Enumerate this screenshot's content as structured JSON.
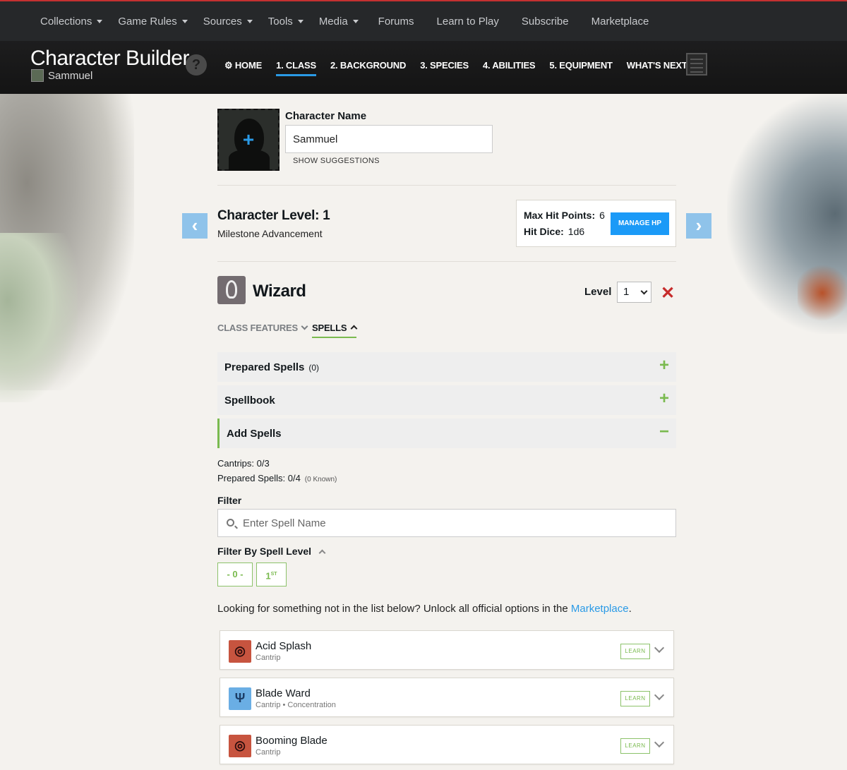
{
  "topnav": {
    "items": [
      {
        "label": "Collections",
        "dropdown": true
      },
      {
        "label": "Game Rules",
        "dropdown": true
      },
      {
        "label": "Sources",
        "dropdown": true
      },
      {
        "label": "Tools",
        "dropdown": true
      },
      {
        "label": "Media",
        "dropdown": true
      },
      {
        "label": "Forums",
        "dropdown": false
      },
      {
        "label": "Learn to Play",
        "dropdown": false
      },
      {
        "label": "Subscribe",
        "dropdown": false
      },
      {
        "label": "Marketplace",
        "dropdown": false
      }
    ]
  },
  "builder": {
    "title": "Character Builder",
    "character": "Sammuel",
    "help": "?",
    "steps": [
      {
        "label": "⚙ HOME"
      },
      {
        "label": "1. CLASS",
        "active": true
      },
      {
        "label": "2. BACKGROUND"
      },
      {
        "label": "3. SPECIES"
      },
      {
        "label": "4. ABILITIES"
      },
      {
        "label": "5. EQUIPMENT"
      },
      {
        "label": "WHAT'S NEXT"
      }
    ]
  },
  "character": {
    "portrait_plus": "+",
    "name_label": "Character Name",
    "name_value": "Sammuel",
    "suggestions": "SHOW SUGGESTIONS"
  },
  "level": {
    "title": "Character Level: 1",
    "advancement": "Milestone Advancement",
    "prev": "‹",
    "next": "›",
    "max_hp_label": "Max Hit Points:",
    "max_hp_value": "6",
    "hit_dice_label": "Hit Dice:",
    "hit_dice_value": "1d6",
    "manage_hp": "MANAGE HP"
  },
  "class": {
    "name": "Wizard",
    "level_label": "Level",
    "level_value": "1",
    "remove": "✕"
  },
  "subtabs": {
    "features": "CLASS FEATURES",
    "spells": "SPELLS"
  },
  "accordions": {
    "prepared": {
      "label": "Prepared Spells",
      "count": "(0)",
      "icon": "+"
    },
    "spellbook": {
      "label": "Spellbook",
      "icon": "+"
    },
    "add": {
      "label": "Add Spells",
      "icon": "−"
    }
  },
  "counts": {
    "cantrips": "Cantrips: 0/3",
    "prepared": "Prepared Spells: 0/4",
    "known": "(0 Known)"
  },
  "filter": {
    "label": "Filter",
    "placeholder": "Enter Spell Name",
    "by_level": "Filter By Spell Level",
    "levels": [
      "- 0 -",
      "1"
    ],
    "level_1_suffix": "ST"
  },
  "marketplace": {
    "text": "Looking for something not in the list below? Unlock all official options in the ",
    "link": "Marketplace",
    "end": "."
  },
  "spells": [
    {
      "name": "Acid Splash",
      "meta": "Cantrip",
      "school": "evocation",
      "learn": "LEARN"
    },
    {
      "name": "Blade Ward",
      "meta": "Cantrip • Concentration",
      "school": "abjuration",
      "learn": "LEARN"
    },
    {
      "name": "Booming Blade",
      "meta": "Cantrip",
      "school": "evocation",
      "learn": "LEARN"
    }
  ],
  "colors": {
    "accent_green": "#7aba4f",
    "accent_blue": "#1b9af7",
    "danger": "#c62b2b"
  }
}
